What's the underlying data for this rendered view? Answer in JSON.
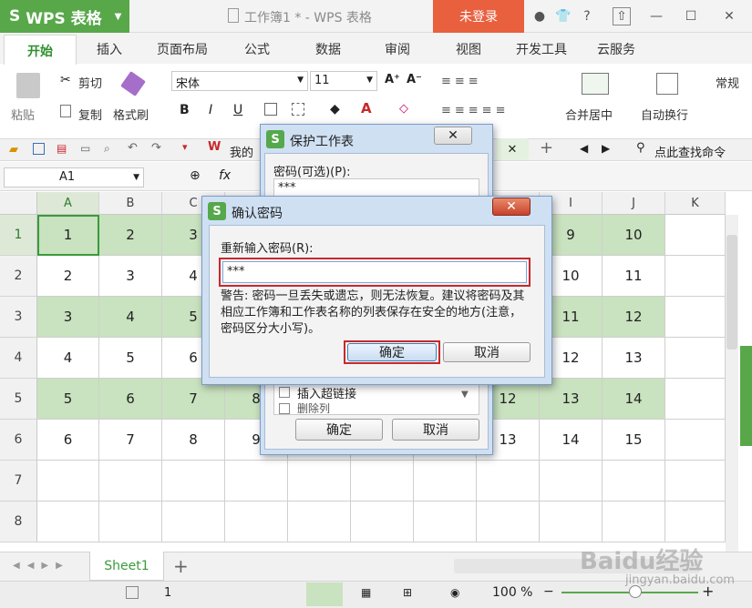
{
  "app": {
    "name": "WPS 表格",
    "doc_title": "工作簿1 * - WPS 表格",
    "login": "未登录"
  },
  "tabs": [
    "开始",
    "插入",
    "页面布局",
    "公式",
    "数据",
    "审阅",
    "视图",
    "开发工具",
    "云服务"
  ],
  "ribbon": {
    "paste": "粘贴",
    "cut": "剪切",
    "copy": "复制",
    "format_painter": "格式刷",
    "font_name": "宋体",
    "font_size": "11",
    "merge_center": "合并居中",
    "wrap_text": "自动换行",
    "number_format": "常规",
    "bold": "B",
    "italic": "I",
    "underline": "U"
  },
  "quickbar": {
    "doc_tab": "我的",
    "search": "点此查找命令"
  },
  "formula_bar": {
    "name_box": "A1",
    "fx": "fx"
  },
  "columns": [
    "A",
    "B",
    "C",
    "D",
    "E",
    "F",
    "G",
    "H",
    "I",
    "J",
    "K"
  ],
  "rows": [
    {
      "num": "1",
      "cells": [
        "1",
        "2",
        "3",
        "",
        "",
        "",
        "",
        "",
        "9",
        "10"
      ]
    },
    {
      "num": "2",
      "cells": [
        "2",
        "3",
        "4",
        "",
        "",
        "",
        "",
        "",
        "10",
        "11"
      ]
    },
    {
      "num": "3",
      "cells": [
        "3",
        "4",
        "5",
        "",
        "",
        "",
        "",
        "",
        "11",
        "12"
      ]
    },
    {
      "num": "4",
      "cells": [
        "4",
        "5",
        "6",
        "",
        "",
        "",
        "",
        "",
        "12",
        "13"
      ]
    },
    {
      "num": "5",
      "cells": [
        "5",
        "6",
        "7",
        "8",
        "",
        "",
        "",
        "12",
        "13",
        "14"
      ]
    },
    {
      "num": "6",
      "cells": [
        "6",
        "7",
        "8",
        "9",
        "",
        "",
        "",
        "13",
        "14",
        "15"
      ]
    },
    {
      "num": "7",
      "cells": [
        "",
        "",
        "",
        "",
        "",
        "",
        "",
        "",
        "",
        ""
      ]
    },
    {
      "num": "8",
      "cells": [
        "",
        "",
        "",
        "",
        "",
        "",
        "",
        "",
        "",
        ""
      ]
    }
  ],
  "sheet_tab": "Sheet1",
  "status": {
    "page": "1",
    "zoom": "100 %"
  },
  "protect_dialog": {
    "title": "保护工作表",
    "password_label": "密码(可选)(P):",
    "password_value": "***",
    "insert_hyperlink": "插入超链接",
    "delete_partial": "删除列",
    "ok": "确定",
    "cancel": "取消"
  },
  "confirm_dialog": {
    "title": "确认密码",
    "reenter_label": "重新输入密码(R):",
    "password_value": "***",
    "warning": "警告: 密码一旦丢失或遗忘，则无法恢复。建议将密码及其相应工作簿和工作表名称的列表保存在安全的地方(注意，密码区分大小写)。",
    "ok": "确定",
    "cancel": "取消"
  },
  "watermark": {
    "brand": "Baidu经验",
    "url": "jingyan.baidu.com"
  },
  "colors": {
    "brand_green": "#58a84a",
    "login_orange": "#e9603f",
    "row_fill": "#c9e2bf",
    "highlight_red": "#c8282c"
  }
}
